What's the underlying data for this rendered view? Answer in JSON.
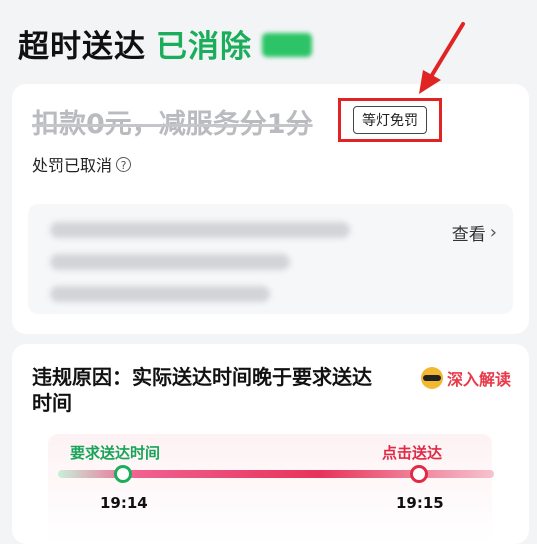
{
  "header": {
    "title": "超时送达",
    "status": "已消除",
    "badge_color": "#2cc466"
  },
  "penalty_card": {
    "penalty": "扣款0元，减服务分1分",
    "waiver_tag": "等灯免罚",
    "cancelled": "处罚已取消",
    "help_icon": "?",
    "view_label": "查看",
    "chevron": "›"
  },
  "reason_card": {
    "title": "违规原因：实际送达时间晚于要求送达时间",
    "deep_read_label": "深入解读",
    "timeline": {
      "left_label": "要求送达时间",
      "left_time": "19:14",
      "right_label": "点击送达",
      "right_time": "19:15"
    }
  },
  "colors": {
    "accent_green": "#1aad5a",
    "accent_red": "#e22a46",
    "annotation_red": "#e02424"
  }
}
